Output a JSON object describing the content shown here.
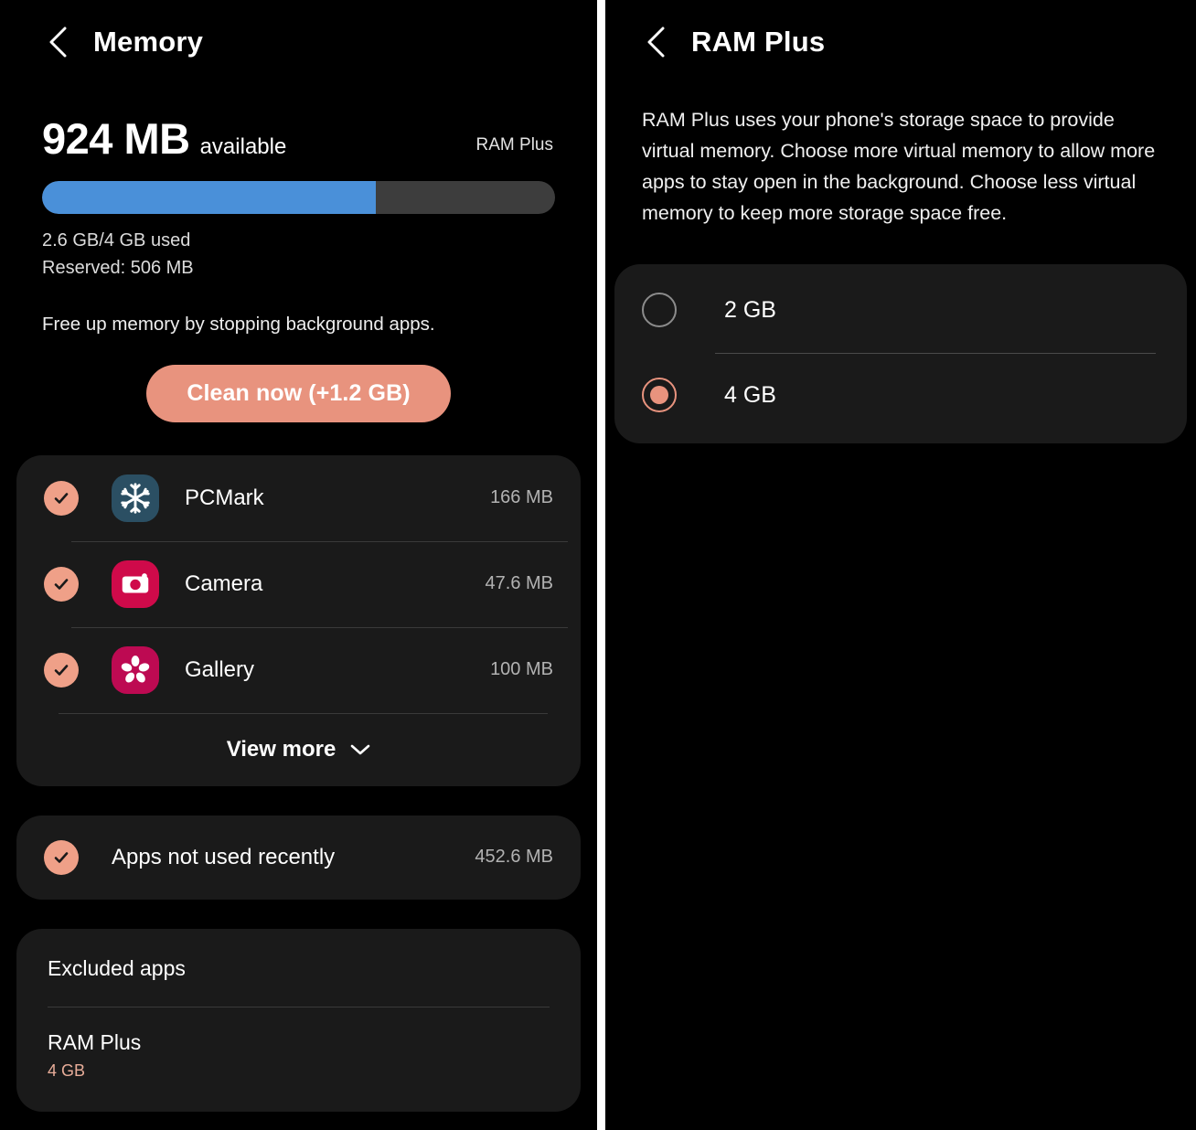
{
  "memory_screen": {
    "back_icon": "chevron-left-icon",
    "title": "Memory",
    "available_number": "924 MB",
    "available_label": "available",
    "ram_plus_tag": "RAM Plus",
    "progress_percent": 65,
    "progress_fill_color": "#4a90d9",
    "progress_track_color": "#3d3d3d",
    "usage_line": "2.6 GB/4 GB used",
    "reserved_line": "Reserved: 506 MB",
    "hint": "Free up memory by stopping background apps.",
    "clean_button": "Clean now (+1.2 GB)",
    "clean_button_color": "#e8937e",
    "apps": [
      {
        "name": "PCMark",
        "size": "166 MB",
        "icon": "snowflake-icon",
        "icon_color": "#2b4f63",
        "checked": true
      },
      {
        "name": "Camera",
        "size": "47.6 MB",
        "icon": "camera-icon",
        "icon_color": "#cf0a4a",
        "checked": true
      },
      {
        "name": "Gallery",
        "size": "100 MB",
        "icon": "flower-icon",
        "icon_color": "#bd0a52",
        "checked": true
      }
    ],
    "view_more": "View more",
    "view_more_icon": "chevron-down-icon",
    "not_used_recently": {
      "label": "Apps not used recently",
      "size": "452.6 MB",
      "checked": true
    },
    "excluded_apps": "Excluded apps",
    "ram_plus_setting": {
      "title": "RAM Plus",
      "value": "4 GB",
      "value_color": "#e8ad99"
    }
  },
  "ram_plus_screen": {
    "back_icon": "chevron-left-icon",
    "title": "RAM Plus",
    "description": "RAM Plus uses your phone's storage space to provide virtual memory. Choose more virtual memory to allow more apps to stay open in the background. Choose less virtual memory to keep more storage space free.",
    "options": [
      {
        "label": "2 GB",
        "selected": false
      },
      {
        "label": "4 GB",
        "selected": true
      }
    ],
    "accent_color": "#e8937e"
  }
}
